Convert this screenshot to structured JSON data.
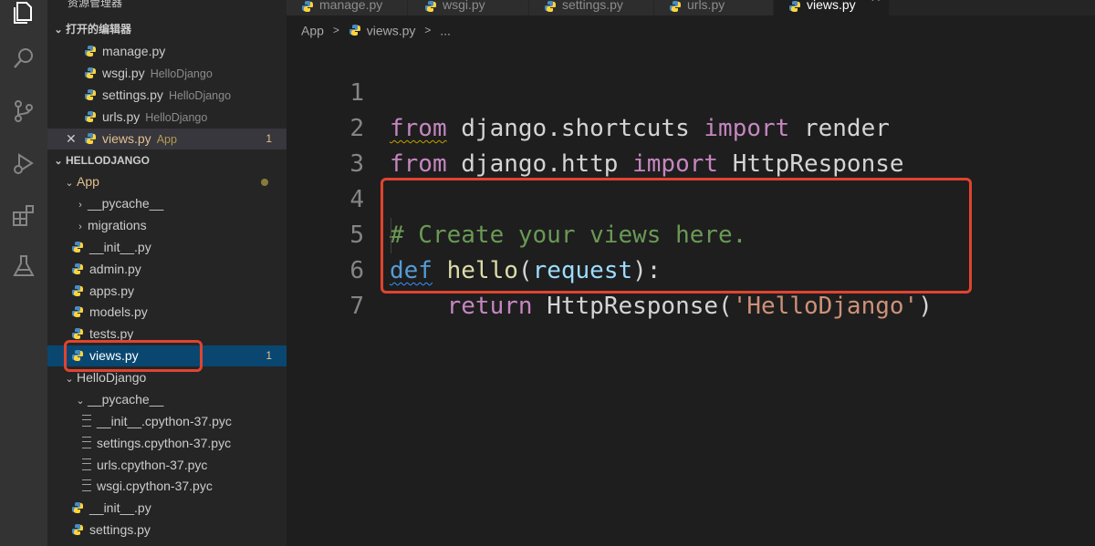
{
  "sidebar": {
    "explorer_title": "资源管理器",
    "open_editors_header": "打开的编辑器",
    "open_editors": [
      {
        "name": "manage.py",
        "desc": ""
      },
      {
        "name": "wsgi.py",
        "desc": "HelloDjango"
      },
      {
        "name": "settings.py",
        "desc": "HelloDjango"
      },
      {
        "name": "urls.py",
        "desc": "HelloDjango"
      },
      {
        "name": "views.py",
        "desc": "App",
        "badge": "1",
        "close": "✕"
      }
    ],
    "project_header": "HELLODJANGO",
    "tree": {
      "app_folder": "App",
      "pycache": "__pycache__",
      "migrations": "migrations",
      "init": "__init__.py",
      "admin": "admin.py",
      "apps": "apps.py",
      "models": "models.py",
      "tests": "tests.py",
      "views": "views.py",
      "views_badge": "1",
      "hellodjango_folder": "HelloDjango",
      "hd_pycache": "__pycache__",
      "pyc_files": [
        "__init__.cpython-37.pyc",
        "settings.cpython-37.pyc",
        "urls.cpython-37.pyc",
        "wsgi.cpython-37.pyc"
      ],
      "hd_init": "__init__.py",
      "hd_settings": "settings.py"
    }
  },
  "tabs": [
    {
      "label": "manage.py"
    },
    {
      "label": "wsgi.py"
    },
    {
      "label": "settings.py"
    },
    {
      "label": "urls.py"
    },
    {
      "label": "views.py",
      "active": true,
      "close": "✕"
    }
  ],
  "breadcrumb": {
    "folder": "App",
    "sep": ">",
    "file": "views.py",
    "more": "..."
  },
  "editor": {
    "line_numbers": [
      "1",
      "2",
      "3",
      "4",
      "5",
      "6",
      "7"
    ],
    "line1": {
      "kw1": "from",
      "mod": " django.shortcuts ",
      "kw2": "import",
      "name": " render"
    },
    "line2": {
      "kw1": "from",
      "mod": " django.http ",
      "kw2": "import",
      "name": " HttpResponse"
    },
    "line4": {
      "comment": "# Create your views here."
    },
    "line5": {
      "kw": "def",
      "sp": " ",
      "fn": "hello",
      "open": "(",
      "param": "request",
      "close": "):"
    },
    "line6": {
      "indent": "    ",
      "kw": "return",
      "sp": " ",
      "cls": "HttpResponse",
      "open": "(",
      "str": "'HelloDjango'",
      "close": ")"
    }
  },
  "colors": {
    "highlight_box": "#e0442f",
    "selection": "#094771",
    "python_blue": "#4b8bbe",
    "python_yellow": "#ffd43b"
  }
}
